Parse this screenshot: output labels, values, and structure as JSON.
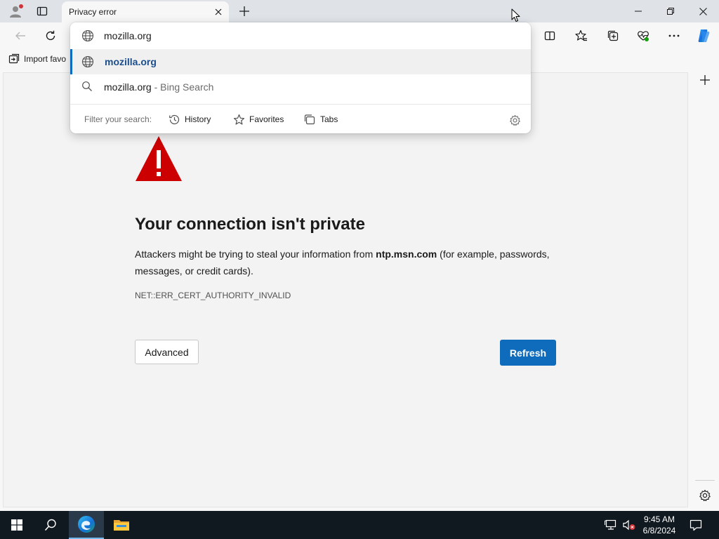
{
  "browser": {
    "tab": {
      "title": "Privacy error"
    },
    "favorites_bar": {
      "import_label": "Import favo"
    }
  },
  "address_dropdown": {
    "input_value": "mozilla.org",
    "suggestions": [
      {
        "text": "mozilla.org",
        "suffix": "",
        "icon": "globe-icon"
      },
      {
        "text": "mozilla.org",
        "suffix": " - Bing Search",
        "icon": "search-icon"
      }
    ],
    "filter": {
      "label": "Filter your search:",
      "history": "History",
      "favorites": "Favorites",
      "tabs": "Tabs"
    }
  },
  "page": {
    "title": "Your connection isn't private",
    "desc_before": "Attackers might be trying to steal your information from ",
    "host": "ntp.msn.com",
    "desc_after": " (for example, passwords, messages, or credit cards).",
    "error_code": "NET::ERR_CERT_AUTHORITY_INVALID",
    "advanced_label": "Advanced",
    "refresh_label": "Refresh"
  },
  "taskbar": {
    "time": "9:45 AM",
    "date": "6/8/2024"
  },
  "colors": {
    "accent": "#0f6cbd",
    "warning": "#cc0000"
  }
}
